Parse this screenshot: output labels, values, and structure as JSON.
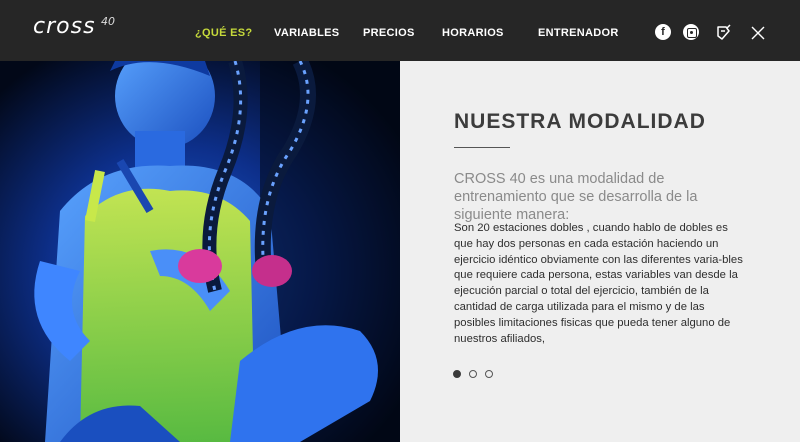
{
  "brand": {
    "logo_text": "cross",
    "logo_sup": "40"
  },
  "nav": {
    "items": [
      {
        "label": "¿QUÉ ES?",
        "active": true
      },
      {
        "label": "VARIABLES",
        "active": false
      },
      {
        "label": "PRECIOS",
        "active": false
      },
      {
        "label": "HORARIOS",
        "active": false
      },
      {
        "label": "ENTRENADOR",
        "active": false
      }
    ],
    "accent_color": "#c6da3b"
  },
  "social": {
    "facebook_glyph": "f",
    "icons": [
      "facebook-icon",
      "instagram-icon",
      "foursquare-icon",
      "close-icon"
    ]
  },
  "section": {
    "title": "NUESTRA MODALIDAD",
    "lead": "CROSS 40 es una modalidad de entrenamiento que se desarrolla de la siguiente manera:",
    "body": "Son 20 estaciones dobles , cuando hablo de dobles es que hay dos personas en cada estación haciendo un ejercicio idéntico obviamente con las diferentes varia-bles que requiere cada persona, estas variables van desde la ejecución parcial o total del ejercicio, también de la cantidad de carga utilizada para el mismo y de las posibles limitaciones fisicas que pueda tener alguno de nuestros afiliados,"
  },
  "slider": {
    "count": 3,
    "active_index": 0
  },
  "colors": {
    "topbar": "#262626",
    "panel_bg": "#efefef",
    "hero_tint": "#0a2a7a"
  }
}
